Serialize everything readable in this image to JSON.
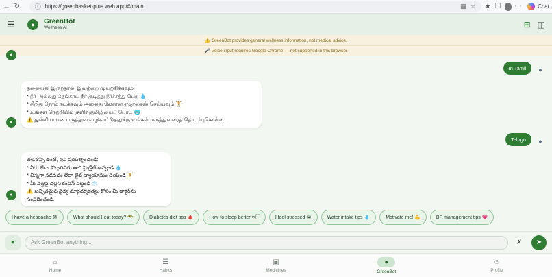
{
  "browser": {
    "url": "https://greenbasket-plus.web.app/#/main",
    "chat_label": "Chat"
  },
  "header": {
    "title": "GreenBot",
    "subtitle": "Wellness AI"
  },
  "notices": {
    "disclaimer": "⚠️ GreenBot provides general wellness information, not medical advice.",
    "voice": "🎤 Voice input requires Google Chrome — not supported in this browser"
  },
  "messages": {
    "user1": "In Tamil",
    "bot1": [
      "தலைவலி இருந்தால், இவற்றை முயற்சிக்கவும்:",
      "* நீர் அல்லது தேங்காய் நீர் குடித்து நீர்ச்சத்து பெற 💧",
      "* சிறிது நேரம் நடக்கவும் அல்லது லேசான எஜர்சைஸ் செய்யவும் 🏋",
      "* உங்கள் நெற்றியில் குளிர் குமிழியைப் போட 🥶",
      "⚠️ துல்லியமான மருத்துவ வழிகாட்டுதலுக்கு உங்கள் மருத்துவரைத் தொடர்புகொள்ள."
    ],
    "user2": "Telugu",
    "bot2": [
      "తలనొప్పి ఉంటే, ఇవి ప్రయత్నించండి:",
      "* నీరు లేదా కొబ్బరినీరు తాగి హైడ్రేట్ అవ్వండి 💧",
      "* చిన్నగా నడవడం లేదా లైట్ వ్యాయామం చేయండి 🏋",
      "* మీ నెత్తిపై చల్లని కంప్రెస్ పెట్టండి ❄️",
      "⚠️ ఖచ్చితమైన వైద్య మార్గదర్శకత్వం కోసం మీ డాక్టర్‌ను సంప్రదించండి."
    ]
  },
  "chips": [
    "I have a headache 😟",
    "What should I eat today? 🥗",
    "Diabetes diet tips 🩸",
    "How to sleep better 😴",
    "I feel stressed 😰",
    "Water intake tips 💧",
    "Motivate me! 💪",
    "BP management tips 💗"
  ],
  "input": {
    "placeholder": "Ask GreenBot anything..."
  },
  "nav": {
    "home": "Home",
    "habits": "Habits",
    "medicines": "Medicines",
    "greenbot": "GreenBot",
    "profile": "Profile"
  },
  "colors": {
    "brand": "#2e7d32",
    "notice_bg": "#f8f1df"
  }
}
